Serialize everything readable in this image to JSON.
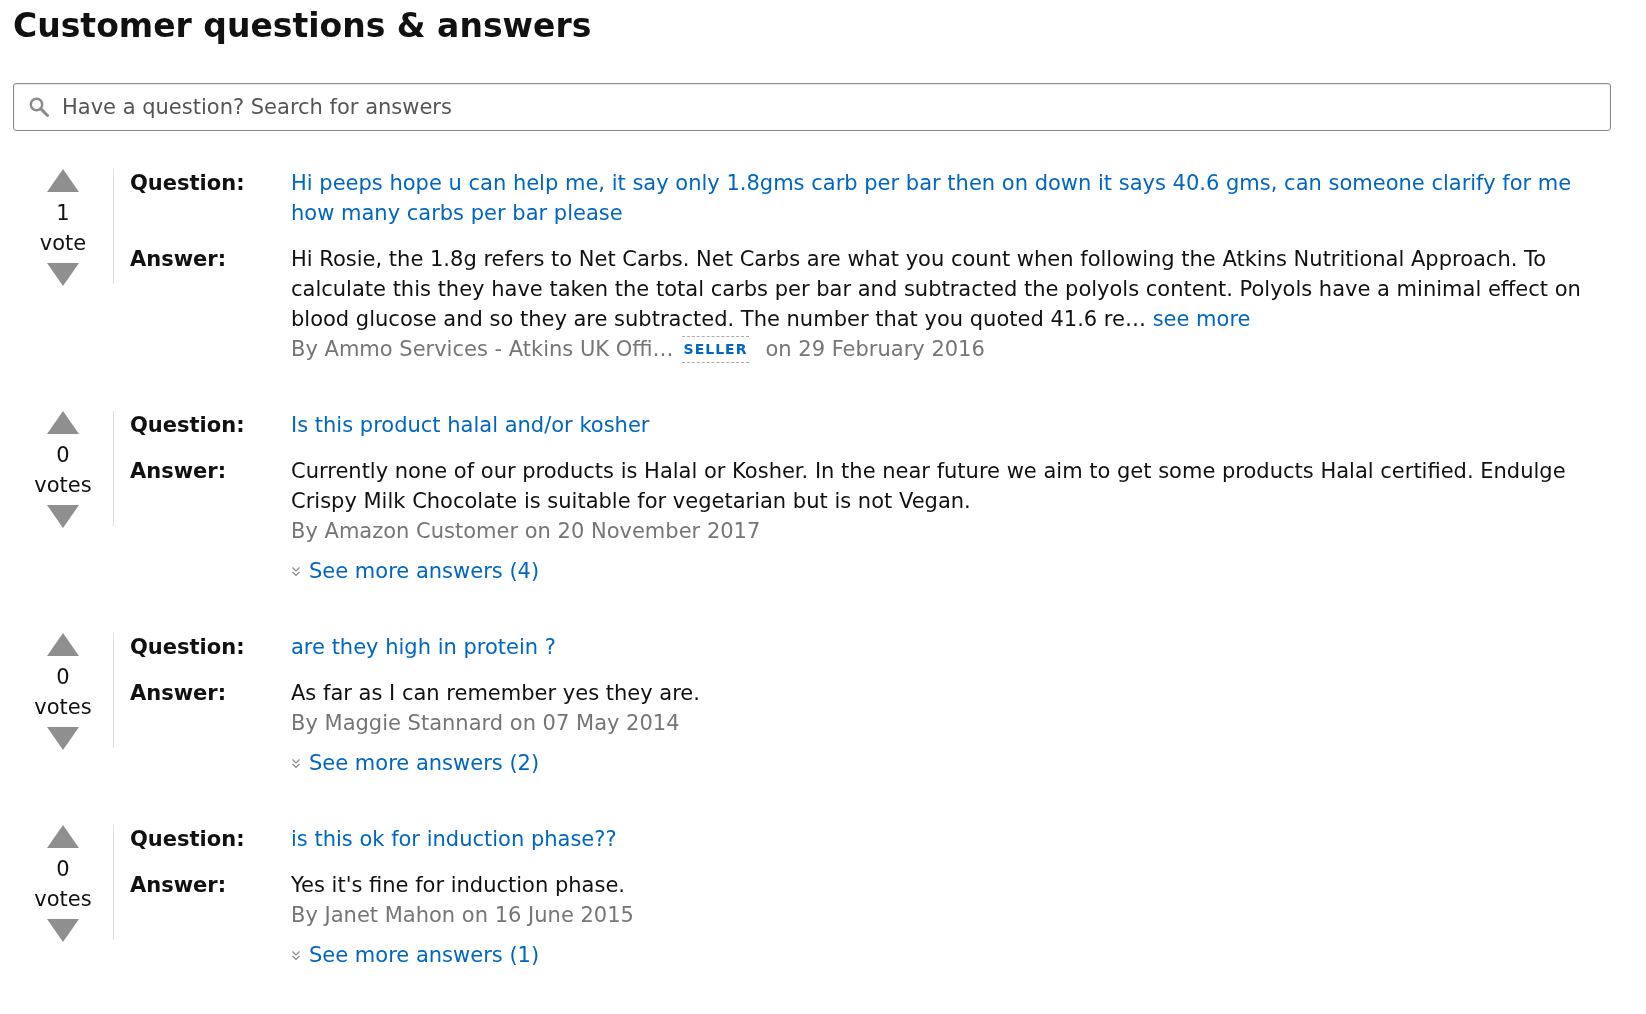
{
  "title": "Customer questions & answers",
  "search": {
    "placeholder": "Have a question? Search for answers"
  },
  "questions": [
    {
      "votes": "1",
      "votes_label": "vote",
      "question_label": "Question:",
      "question": "Hi peeps hope u can help me, it say only 1.8gms carb per bar then on down it says 40.6 gms, can someone clarify for me how many carbs per bar please",
      "answer_label": "Answer:",
      "answer": "Hi Rosie, the 1.8g refers to Net Carbs. Net Carbs are what you count when following the Atkins Nutritional Approach. To calculate this they have taken the total carbs per bar and subtracted the polyols content. Polyols have a minimal effect on blood glucose and so they are subtracted. The number that you quoted 41.6 re…",
      "answer_link": "see more",
      "byline": "By Ammo Services - Atkins UK Offi…",
      "badge": "SELLER",
      "date": "on 29 February 2016"
    },
    {
      "votes": "0",
      "votes_label": "votes",
      "question_label": "Question:",
      "question": "Is this product halal and/or kosher",
      "answer_label": "Answer:",
      "answer": "Currently none of our products is Halal or Kosher. In the near future we aim to get some products Halal certified. Endulge Crispy Milk Chocolate is suitable for vegetarian but is not Vegan.",
      "byline": "By Amazon Customer on 20 November 2017",
      "more_answers": "See more answers (4)"
    },
    {
      "votes": "0",
      "votes_label": "votes",
      "question_label": "Question:",
      "question": "are they high in protein ?",
      "answer_label": "Answer:",
      "answer": "As far as I can remember yes they are.",
      "byline": "By Maggie Stannard on 07 May 2014",
      "more_answers": "See more answers (2)"
    },
    {
      "votes": "0",
      "votes_label": "votes",
      "question_label": "Question:",
      "question": "is this ok for induction phase??",
      "answer_label": "Answer:",
      "answer": "Yes it's fine for induction phase.",
      "byline": "By Janet Mahon on 16 June 2015",
      "more_answers": "See more answers (1)"
    }
  ]
}
